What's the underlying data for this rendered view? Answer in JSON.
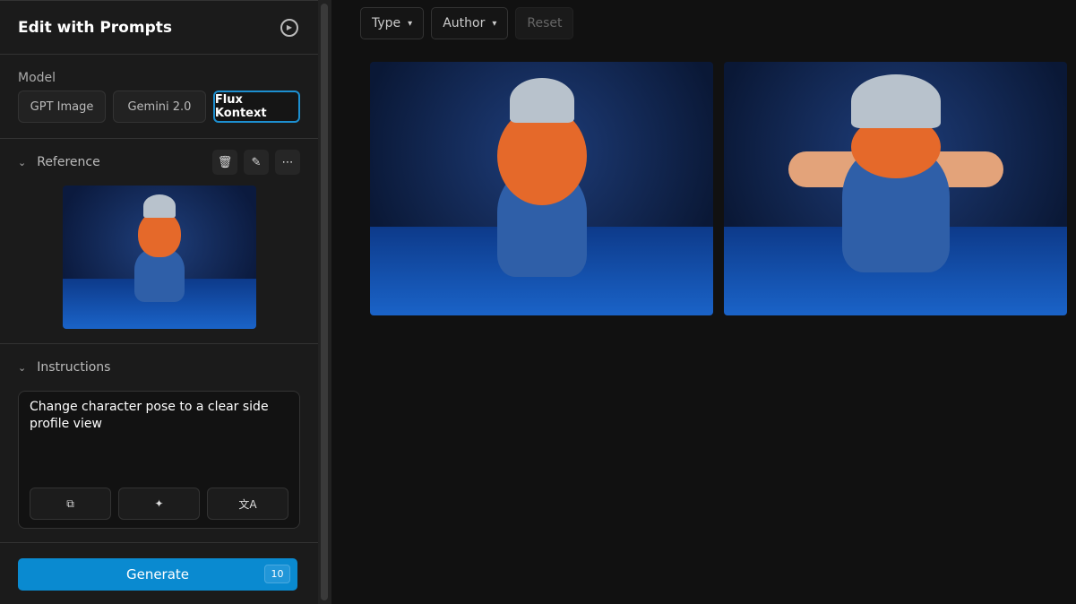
{
  "panel": {
    "title": "Edit with Prompts",
    "model_label": "Model",
    "models": [
      {
        "label": "GPT Image"
      },
      {
        "label": "Gemini 2.0"
      },
      {
        "label": "Flux Kontext"
      }
    ],
    "selected_model": "Flux Kontext",
    "reference": {
      "label": "Reference"
    },
    "instructions": {
      "label": "Instructions",
      "value": "Change character pose to a clear side profile view"
    },
    "generate": {
      "label": "Generate",
      "credits": "10"
    }
  },
  "filters": {
    "type": "Type",
    "author": "Author",
    "reset": "Reset"
  },
  "colors": {
    "accent": "#0a8ad0"
  }
}
